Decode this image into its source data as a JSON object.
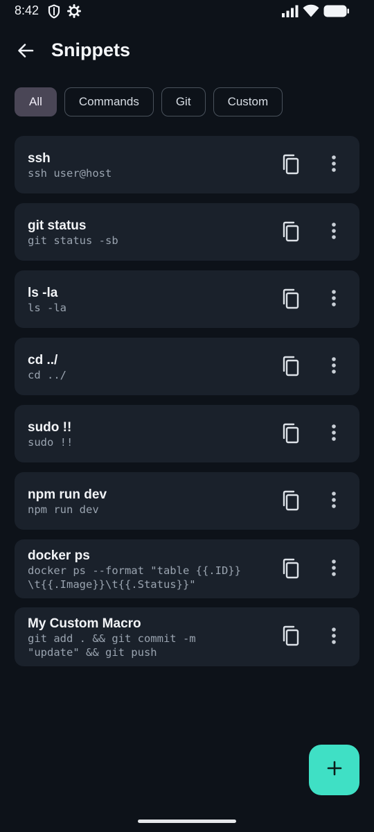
{
  "status_bar": {
    "time": "8:42",
    "icons": [
      "shield-icon",
      "gear-icon",
      "signal-icon",
      "wifi-icon",
      "battery-icon"
    ]
  },
  "header": {
    "back_icon": "arrow-left-icon",
    "title": "Snippets"
  },
  "filters": {
    "selected": "All",
    "chips": [
      "All",
      "Commands",
      "Git",
      "Custom"
    ]
  },
  "snippets": [
    {
      "title": "ssh",
      "command": "ssh user@host"
    },
    {
      "title": "git status",
      "command": "git status -sb"
    },
    {
      "title": "ls -la",
      "command": "ls -la"
    },
    {
      "title": "cd ../",
      "command": "cd ../"
    },
    {
      "title": "sudo !!",
      "command": "sudo !!"
    },
    {
      "title": "npm run dev",
      "command": "npm run dev"
    },
    {
      "title": "docker ps",
      "command": "docker ps --format \"table {{.ID}}\n\\t{{.Image}}\\t{{.Status}}\""
    },
    {
      "title": "My Custom Macro",
      "command": "git add . && git commit -m\n\"update\" && git push"
    }
  ],
  "fab": {
    "icon": "plus-icon"
  },
  "colors": {
    "background": "#0d1219",
    "card": "#1a212b",
    "selected_chip": "#4a4656",
    "accent": "#3fe0c5"
  }
}
